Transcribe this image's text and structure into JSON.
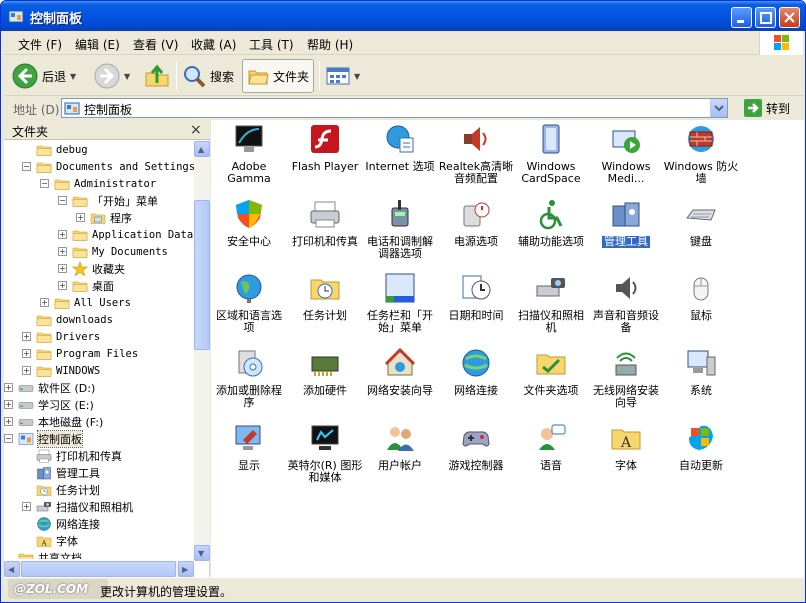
{
  "window": {
    "title": "控制面板",
    "colors": {
      "titlebar": "#0054e3",
      "selection": "#316ac5",
      "chrome": "#ece9d8"
    }
  },
  "menu": [
    "文件 (F)",
    "编辑 (E)",
    "查看 (V)",
    "收藏 (A)",
    "工具 (T)",
    "帮助 (H)"
  ],
  "toolbar": {
    "back_label": "后退",
    "search_label": "搜索",
    "folders_label": "文件夹"
  },
  "address": {
    "label": "地址 (D)",
    "value": "控制面板",
    "go_label": "转到"
  },
  "folder_pane": {
    "title": "文件夹",
    "close_glyph": "×",
    "tree": [
      {
        "label": "debug",
        "icon": "folder-icon",
        "exp": "",
        "mono": true
      },
      {
        "label": "Documents and Settings",
        "icon": "folder-icon",
        "exp": "−",
        "mono": true
      },
      {
        "label": "Administrator",
        "icon": "folder-icon",
        "exp": "−",
        "mono": true
      },
      {
        "label": "「开始」菜单",
        "icon": "folder-icon",
        "exp": "−",
        "mono": false
      },
      {
        "label": "程序",
        "icon": "programs-folder-icon",
        "exp": "+",
        "mono": false
      },
      {
        "label": "Application Data",
        "icon": "folder-icon",
        "exp": "+",
        "mono": true
      },
      {
        "label": "My Documents",
        "icon": "folder-icon",
        "exp": "+",
        "mono": true
      },
      {
        "label": "收藏夹",
        "icon": "favorites-star-icon",
        "exp": "+",
        "mono": false
      },
      {
        "label": "桌面",
        "icon": "folder-icon",
        "exp": "+",
        "mono": false
      },
      {
        "label": "All Users",
        "icon": "folder-icon",
        "exp": "+",
        "mono": true
      },
      {
        "label": "downloads",
        "icon": "folder-icon",
        "exp": "",
        "mono": true
      },
      {
        "label": "Drivers",
        "icon": "folder-icon",
        "exp": "+",
        "mono": true
      },
      {
        "label": "Program Files",
        "icon": "folder-icon",
        "exp": "+",
        "mono": true
      },
      {
        "label": "WINDOWS",
        "icon": "folder-icon",
        "exp": "+",
        "mono": true
      },
      {
        "label": "软件区  (D:)",
        "icon": "drive-icon",
        "exp": "+",
        "mono": false
      },
      {
        "label": "学习区  (E:)",
        "icon": "drive-icon",
        "exp": "+",
        "mono": false
      },
      {
        "label": "本地磁盘  (F:)",
        "icon": "drive-icon",
        "exp": "+",
        "mono": false
      },
      {
        "label": "控制面板",
        "icon": "control-panel-icon",
        "exp": "−",
        "mono": false,
        "selected": true
      },
      {
        "label": "打印机和传真",
        "icon": "printer-icon",
        "exp": "",
        "mono": false
      },
      {
        "label": "管理工具",
        "icon": "admin-tools-icon",
        "exp": "",
        "mono": false
      },
      {
        "label": "任务计划",
        "icon": "scheduled-tasks-icon",
        "exp": "",
        "mono": false
      },
      {
        "label": "扫描仪和照相机",
        "icon": "scanner-icon",
        "exp": "+",
        "mono": false
      },
      {
        "label": "网络连接",
        "icon": "network-icon",
        "exp": "",
        "mono": false
      },
      {
        "label": "字体",
        "icon": "fonts-folder-icon",
        "exp": "",
        "mono": false
      },
      {
        "label": "共享文档",
        "icon": "folder-icon",
        "exp": "",
        "mono": false
      }
    ]
  },
  "items": [
    {
      "label": "Adobe Gamma",
      "icon": "monitor-gamma-icon"
    },
    {
      "label": "Flash Player",
      "icon": "flash-icon"
    },
    {
      "label": "Internet 选项",
      "icon": "internet-options-icon"
    },
    {
      "label": "Realtek高清晰音频配置",
      "icon": "speaker-icon"
    },
    {
      "label": "Windows CardSpace",
      "icon": "cardspace-icon"
    },
    {
      "label": "Windows Medi...",
      "icon": "media-icon"
    },
    {
      "label": "Windows 防火墙",
      "icon": "firewall-icon"
    },
    {
      "label": "安全中心",
      "icon": "shield-icon"
    },
    {
      "label": "打印机和传真",
      "icon": "printer-icon"
    },
    {
      "label": "电话和调制解调器选项",
      "icon": "phone-icon"
    },
    {
      "label": "电源选项",
      "icon": "power-icon"
    },
    {
      "label": "辅助功能选项",
      "icon": "accessibility-icon"
    },
    {
      "label": "管理工具",
      "icon": "admin-tools-icon",
      "selected": true
    },
    {
      "label": "键盘",
      "icon": "keyboard-icon"
    },
    {
      "label": "区域和语言选项",
      "icon": "globe-icon"
    },
    {
      "label": "任务计划",
      "icon": "scheduled-tasks-icon"
    },
    {
      "label": "任务栏和「开始」菜单",
      "icon": "taskbar-icon"
    },
    {
      "label": "日期和时间",
      "icon": "clock-icon"
    },
    {
      "label": "扫描仪和照相机",
      "icon": "scanner-icon"
    },
    {
      "label": "声音和音频设备",
      "icon": "sound-icon"
    },
    {
      "label": "鼠标",
      "icon": "mouse-icon"
    },
    {
      "label": "添加或删除程序",
      "icon": "add-remove-icon"
    },
    {
      "label": "添加硬件",
      "icon": "hardware-icon"
    },
    {
      "label": "网络安装向导",
      "icon": "network-wizard-icon"
    },
    {
      "label": "网络连接",
      "icon": "network-icon"
    },
    {
      "label": "文件夹选项",
      "icon": "folder-options-icon"
    },
    {
      "label": "无线网络安装向导",
      "icon": "wireless-icon"
    },
    {
      "label": "系统",
      "icon": "system-icon"
    },
    {
      "label": "显示",
      "icon": "display-icon"
    },
    {
      "label": "英特尔(R) 图形和媒体",
      "icon": "intel-graphics-icon"
    },
    {
      "label": "用户帐户",
      "icon": "user-accounts-icon"
    },
    {
      "label": "游戏控制器",
      "icon": "gamepad-icon"
    },
    {
      "label": "语音",
      "icon": "speech-icon"
    },
    {
      "label": "字体",
      "icon": "fonts-folder-icon"
    },
    {
      "label": "自动更新",
      "icon": "update-icon"
    }
  ],
  "status": {
    "text": "更改计算机的管理设置。",
    "watermark": "@ZOL.COM"
  }
}
